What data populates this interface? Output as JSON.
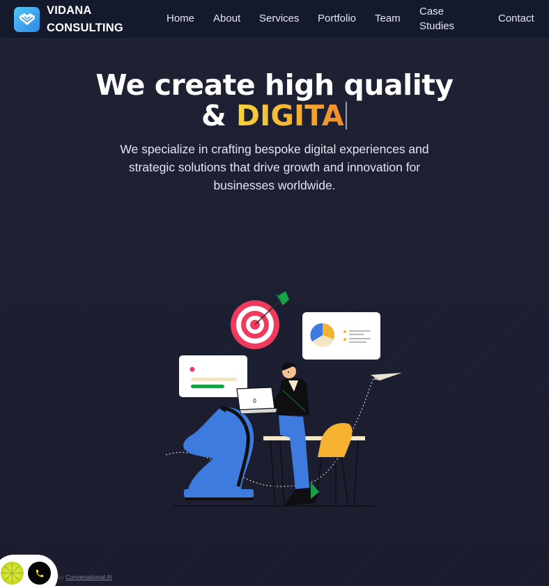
{
  "nav": {
    "brand_line1": "VIDANA",
    "brand_line2": "CONSULTING",
    "logo_icon": "handshake-icon",
    "links": {
      "home": "Home",
      "about": "About",
      "services": "Services",
      "portfolio": "Portfolio",
      "team": "Team",
      "case_line1": "Case",
      "case_line2": "Studies",
      "contact": "Contact"
    }
  },
  "hero": {
    "title_line1": "We create high quality",
    "title_prefix": "&",
    "title_typed": "DIGITA",
    "subtitle": "We specialize in crafting bespoke digital experiences and strategic solutions that drive growth and innovation for businesses worldwide.",
    "illustration_icon": "businessman-strategy-illustration"
  },
  "widget": {
    "logo_icon": "brand-orb-icon",
    "call_icon": "phone-icon",
    "powered_prefix": "by",
    "powered_text": "Conversational AI"
  },
  "colors": {
    "background": "#1c1f31",
    "navbar": "#141a2b",
    "accent_yellow": "#f7d23c",
    "accent_orange": "#f08a2a",
    "text": "#ffffff"
  }
}
